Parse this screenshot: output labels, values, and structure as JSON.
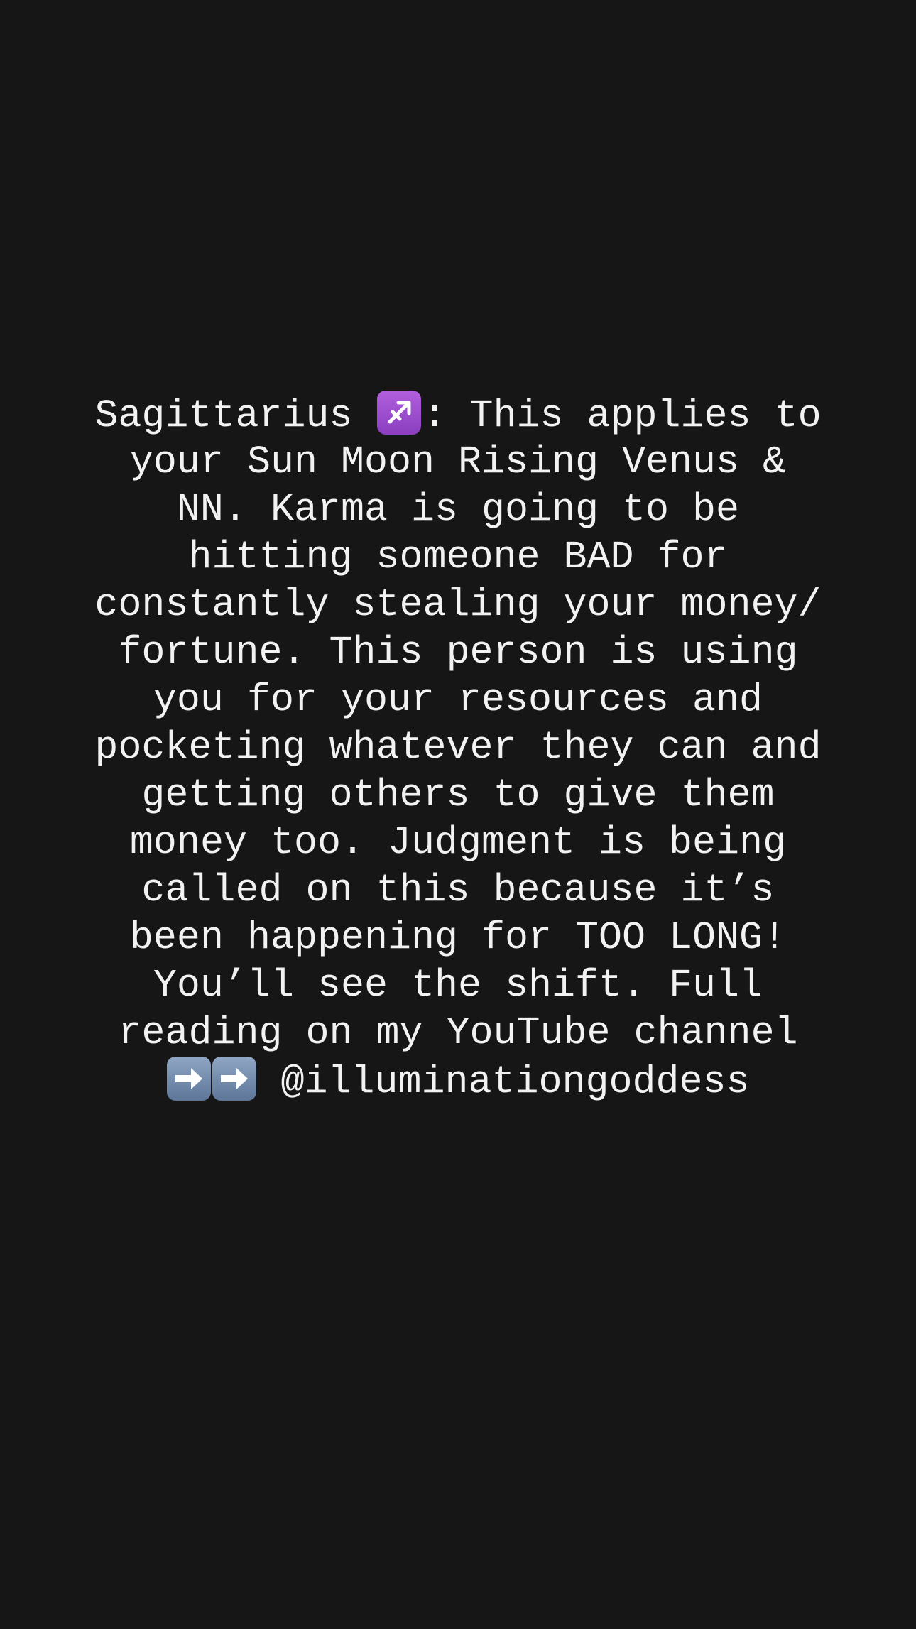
{
  "post": {
    "line1_a": "Sagittarius ",
    "line1_b": ": This applies to",
    "line2": "your Sun Moon Rising Venus &",
    "line3": "NN. Karma is going to be",
    "line4": "hitting someone BAD for",
    "line5": "constantly stealing your money/",
    "line6": "fortune. This person is using",
    "line7": "you for your resources and",
    "line8": "pocketing whatever they can and",
    "line9": "getting others to give them",
    "line10": "money too. Judgment is being",
    "line11": "called on this because it’s",
    "line12": "been happening for TOO LONG!",
    "line13": "You’ll see the shift. Full",
    "line14": "reading on my YouTube channel",
    "line15_handle": " @illuminationgoddess"
  },
  "icons": {
    "zodiac": "sagittarius-emoji",
    "arrows": [
      "right-arrow-emoji",
      "right-arrow-emoji"
    ],
    "zodiac_color": "#9b4fd0",
    "arrow_color": "#7890b0"
  },
  "colors": {
    "background": "#161616",
    "text": "#f2f2f2"
  }
}
